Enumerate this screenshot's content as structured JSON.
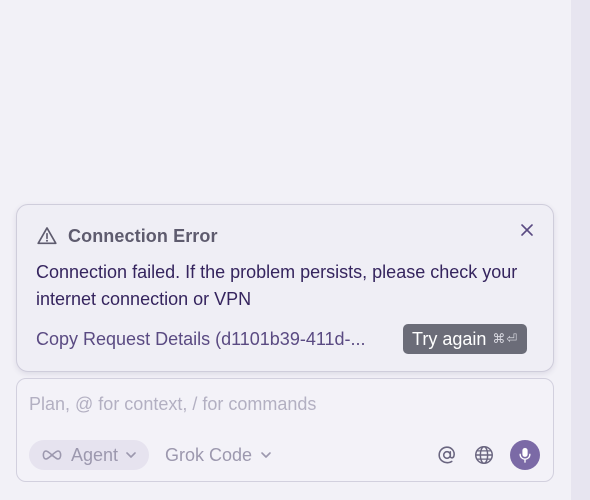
{
  "error": {
    "title": "Connection Error",
    "message": "Connection failed. If the problem persists, please check your internet connection or VPN",
    "copy_link": "Copy Request Details (d1101b39-411d-...",
    "try_again_label": "Try again",
    "try_again_shortcut": "⌘⏎",
    "icons": {
      "header": "warning-icon",
      "close": "close-icon"
    }
  },
  "composer": {
    "placeholder": "Plan, @ for context, / for commands",
    "mode_label": "Agent",
    "mode_icon": "infinity-icon",
    "model_label": "Grok Code",
    "tools": [
      "at-mention-icon",
      "globe-icon",
      "microphone-icon"
    ]
  },
  "colors": {
    "accent": "#7b6aa6",
    "error_text": "#35245e",
    "button_bg": "#6b6c78",
    "background": "#f2f1f7"
  }
}
